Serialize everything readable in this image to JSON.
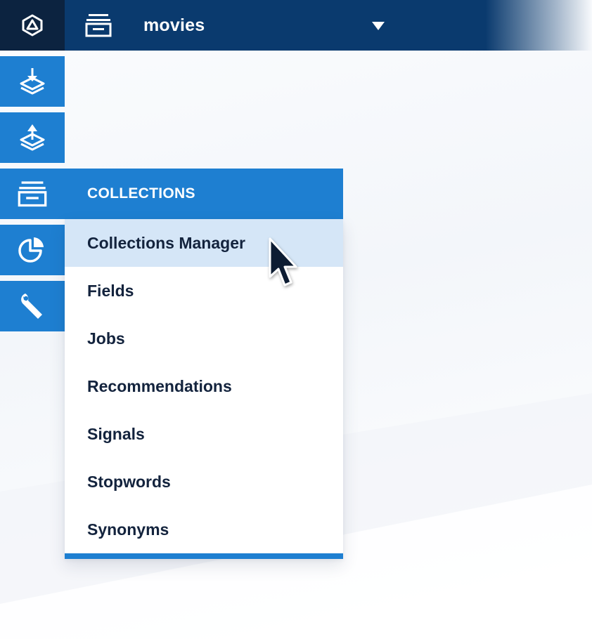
{
  "topbar": {
    "app_name": "movies",
    "logo_icon": "fusion-logo-icon",
    "collection_icon": "collections-icon",
    "dropdown_icon": "caret-down-icon"
  },
  "sidebar": {
    "items": [
      {
        "name": "index-icon",
        "active": false
      },
      {
        "name": "query-icon",
        "active": false
      },
      {
        "name": "collections-icon",
        "active": true
      },
      {
        "name": "analytics-icon",
        "active": false
      },
      {
        "name": "system-icon",
        "active": false
      }
    ]
  },
  "collections_menu": {
    "header": "COLLECTIONS",
    "items": [
      {
        "label": "Collections Manager",
        "hovered": true
      },
      {
        "label": "Fields",
        "hovered": false
      },
      {
        "label": "Jobs",
        "hovered": false
      },
      {
        "label": "Recommendations",
        "hovered": false
      },
      {
        "label": "Signals",
        "hovered": false
      },
      {
        "label": "Stopwords",
        "hovered": false
      },
      {
        "label": "Synonyms",
        "hovered": false
      }
    ]
  },
  "colors": {
    "topbar": "#0a3a6e",
    "logo_cell": "#0c2340",
    "accent": "#1e7fd1",
    "hover": "#d5e6f7",
    "menu_text": "#13233d"
  }
}
